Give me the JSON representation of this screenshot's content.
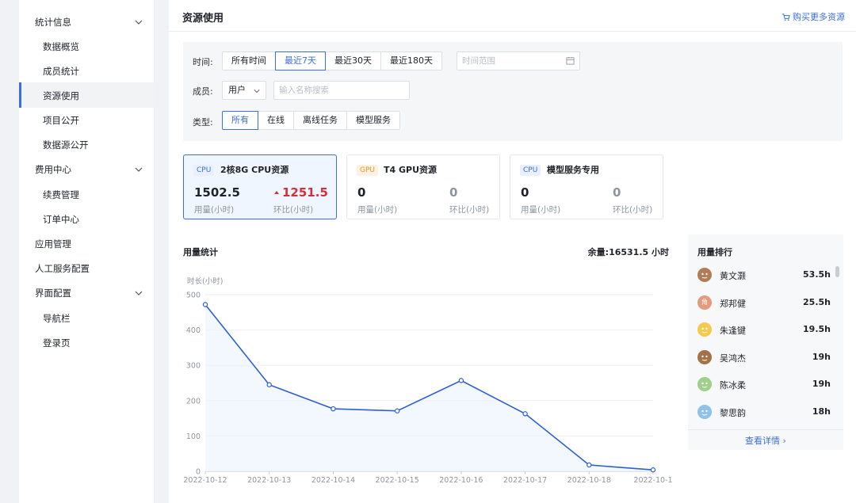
{
  "sidebar": {
    "groups": [
      {
        "label": "统计信息",
        "items": [
          "数据概览",
          "成员统计",
          "资源使用",
          "项目公开",
          "数据源公开"
        ]
      },
      {
        "label": "费用中心",
        "items": [
          "续费管理",
          "订单中心"
        ]
      },
      {
        "label": "应用管理"
      },
      {
        "label": "人工服务配置"
      },
      {
        "label": "界面配置",
        "items": [
          "导航栏",
          "登录页"
        ]
      }
    ],
    "active_item": "资源使用"
  },
  "header": {
    "title": "资源使用",
    "buy_more_label": "购买更多资源",
    "buy_icon": "cart-icon"
  },
  "filters": {
    "time": {
      "label": "时间:",
      "options": [
        "所有时间",
        "最近7天",
        "最近30天",
        "最近180天"
      ],
      "selected": "最近7天",
      "range_placeholder": "时间范围"
    },
    "member": {
      "label": "成员:",
      "select_value": "用户",
      "search_placeholder": "输入名称搜索"
    },
    "type": {
      "label": "类型:",
      "options": [
        "所有",
        "在线",
        "离线任务",
        "模型服务"
      ],
      "selected": "所有"
    }
  },
  "resource_cards": [
    {
      "tag": "CPU",
      "name": "2核8G CPU资源",
      "usage": "1502.5",
      "usage_label": "用量(小时)",
      "change": "1251.5",
      "change_label": "环比(小时)",
      "trend": "up"
    },
    {
      "tag": "GPU",
      "name": "T4 GPU资源",
      "usage": "0",
      "usage_label": "用量(小时)",
      "change": "0",
      "change_label": "环比(小时)"
    },
    {
      "tag": "CPU",
      "name": "模型服务专用",
      "usage": "0",
      "usage_label": "用量(小时)",
      "change": "0",
      "change_label": "环比(小时)"
    }
  ],
  "usage_stats": {
    "title": "用量统计",
    "remaining_label": "余量:",
    "remaining_value": "16531.5 小时"
  },
  "chart_data": {
    "type": "line",
    "title": "",
    "ylabel": "时长(小时)",
    "xlabel": "",
    "x": [
      "2022-10-12",
      "2022-10-13",
      "2022-10-14",
      "2022-10-15",
      "2022-10-16",
      "2022-10-17",
      "2022-10-18",
      "2022-10-1"
    ],
    "values": [
      472,
      245,
      177,
      171,
      257,
      163,
      18,
      4
    ],
    "ylim": [
      0,
      500
    ],
    "yticks": [
      0,
      100,
      200,
      300,
      400,
      500
    ],
    "grid": true,
    "color": "#2e5fd6"
  },
  "ranking": {
    "title": "用量排行",
    "items": [
      {
        "name": "黄文灏",
        "value": "53.5h",
        "avatar_icon": "dog-avatar-icon",
        "avatar_color": "#b07d58"
      },
      {
        "name": "郑邦健",
        "value": "25.5h",
        "avatar_icon": "text-avatar-icon",
        "avatar_text": "角",
        "avatar_color": "#e39b7b"
      },
      {
        "name": "朱逢键",
        "value": "19.5h",
        "avatar_icon": "bird-avatar-icon",
        "avatar_color": "#f3c94e"
      },
      {
        "name": "吴鸿杰",
        "value": "19h",
        "avatar_icon": "dog-avatar-icon",
        "avatar_color": "#a47148"
      },
      {
        "name": "陈冰柔",
        "value": "19h",
        "avatar_icon": "bear-avatar-icon",
        "avatar_color": "#9fd08a"
      },
      {
        "name": "黎思韵",
        "value": "18h",
        "avatar_icon": "cat-avatar-icon",
        "avatar_color": "#8fc2e8"
      }
    ],
    "detail_label": "查看详情 ›"
  },
  "colors": {
    "accent": "#3b6ee0",
    "up": "#d4303a",
    "line": "#2e5fd6"
  }
}
